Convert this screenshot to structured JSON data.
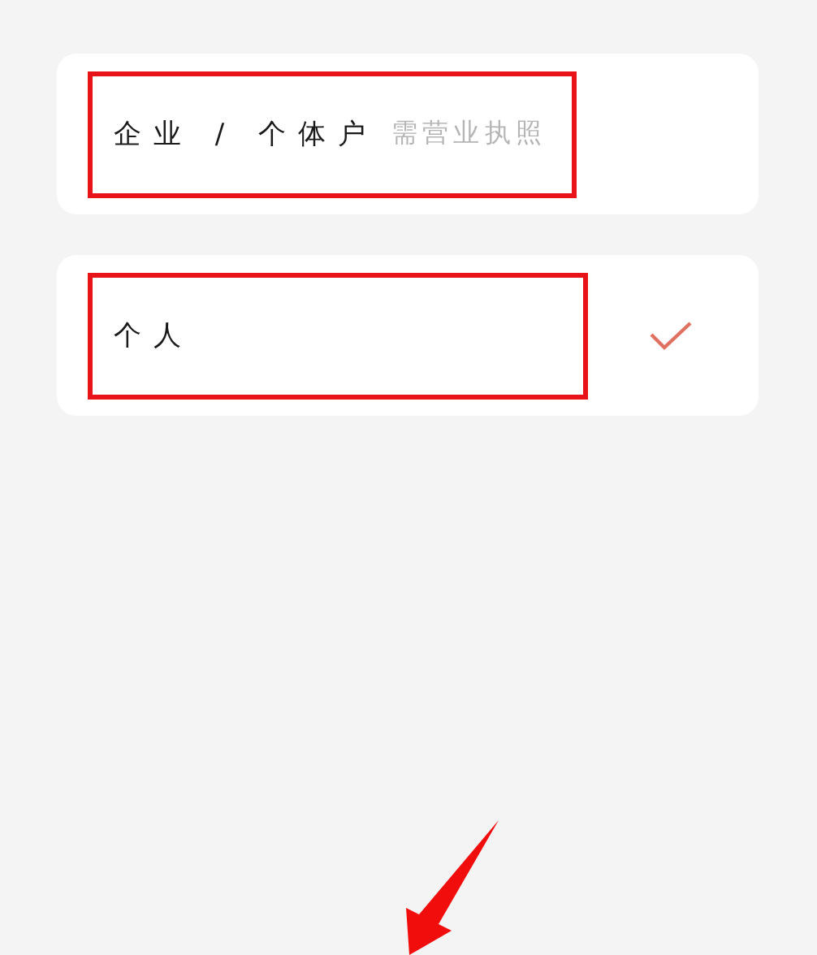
{
  "options": [
    {
      "label": "企业 / 个体户",
      "note": "需营业执照",
      "selected": false,
      "highlighted": true
    },
    {
      "label": "个人",
      "selected": true,
      "highlighted": true
    }
  ],
  "annotation_arrow": true
}
